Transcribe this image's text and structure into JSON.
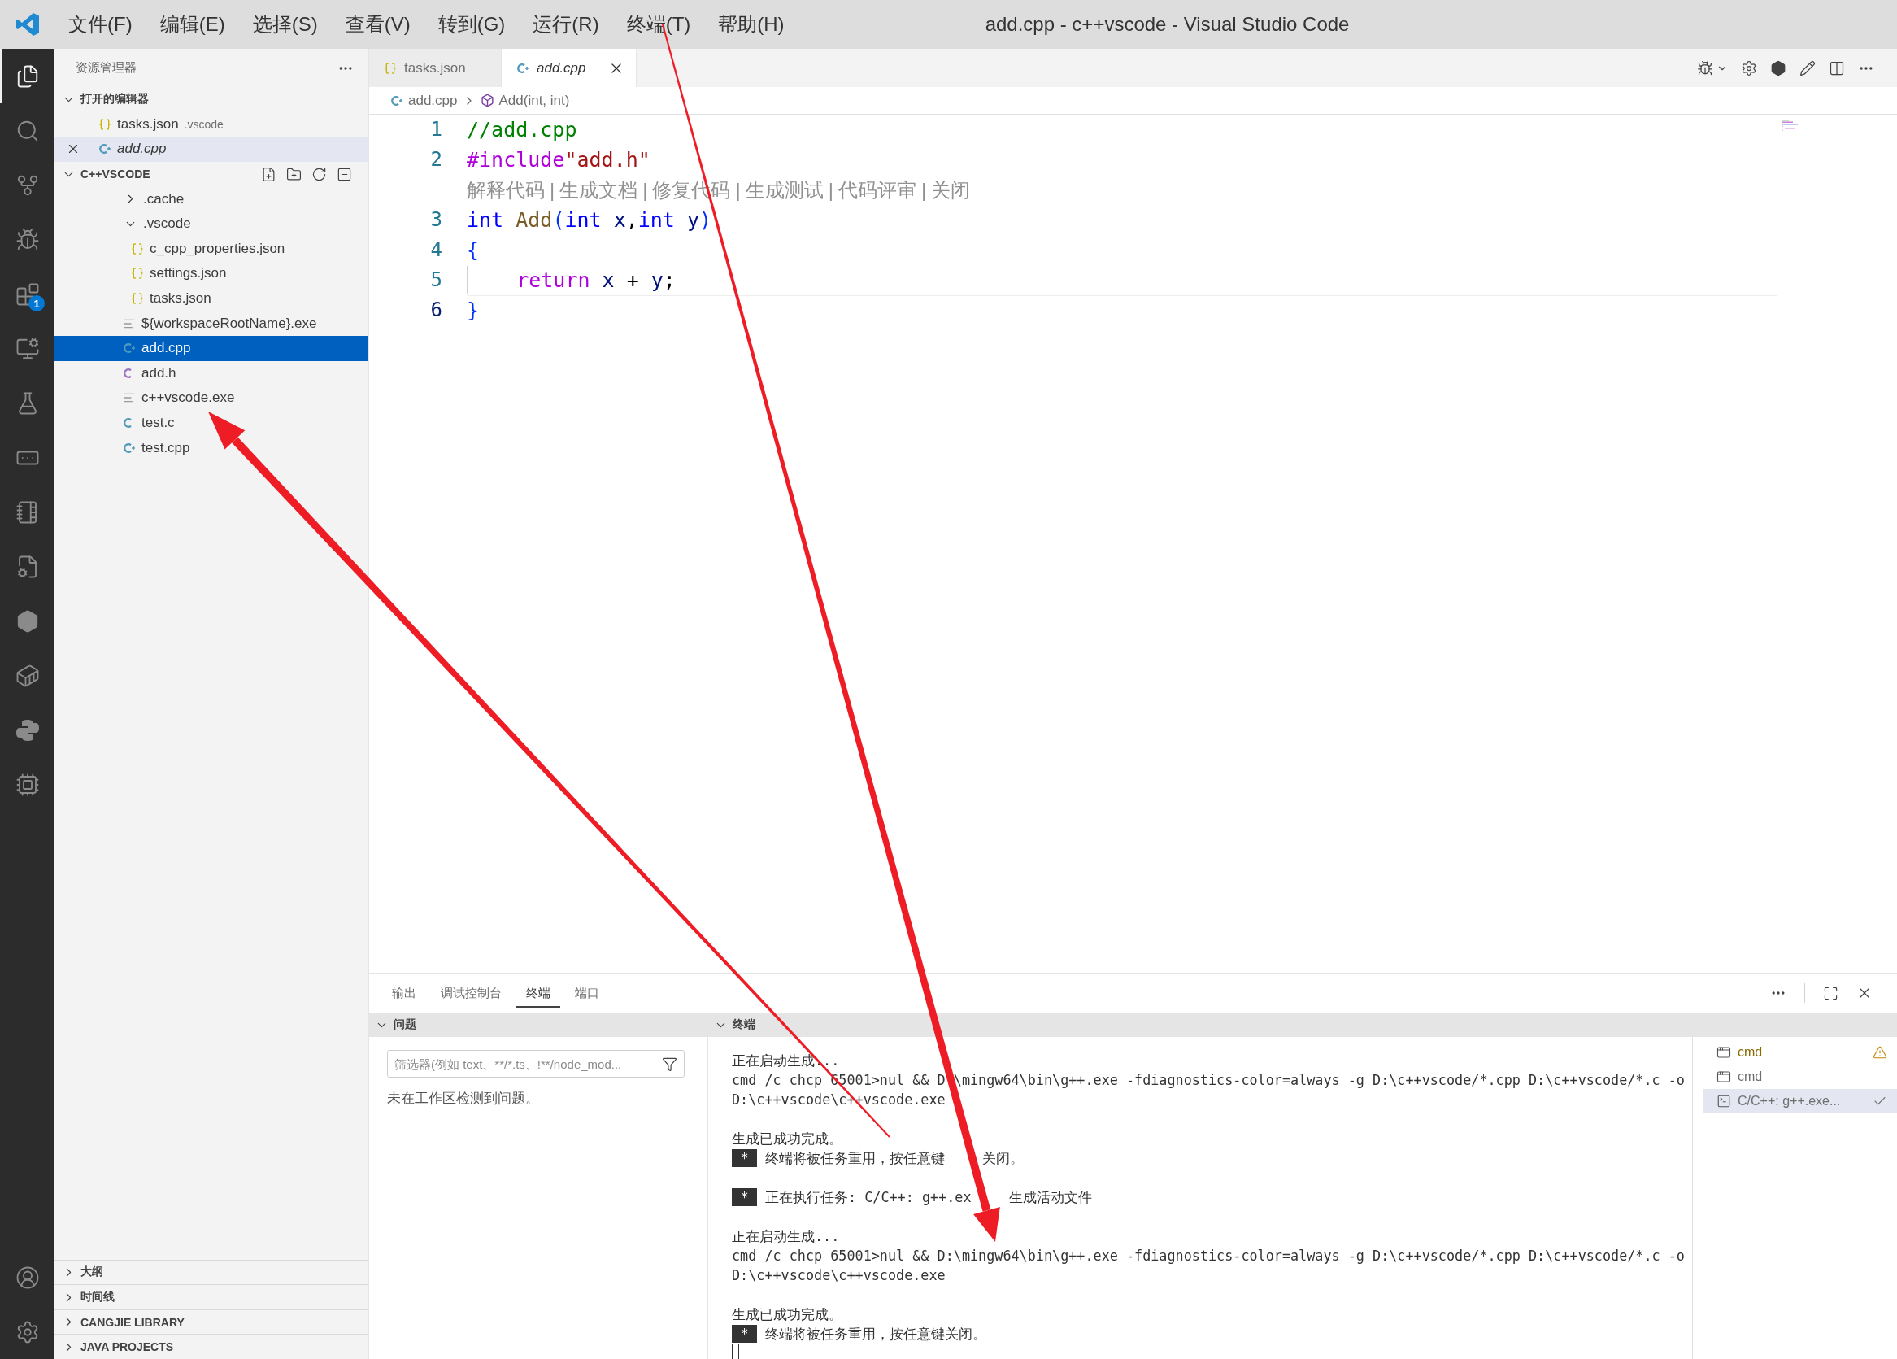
{
  "window": {
    "title": "add.cpp - c++vscode - Visual Studio Code"
  },
  "menu": [
    "文件(F)",
    "编辑(E)",
    "选择(S)",
    "查看(V)",
    "转到(G)",
    "运行(R)",
    "终端(T)",
    "帮助(H)"
  ],
  "activity_bar": {
    "items": [
      {
        "kind": "files",
        "selected": true
      },
      {
        "kind": "search",
        "selected": false
      },
      {
        "kind": "source-control",
        "selected": false
      },
      {
        "kind": "run-debug",
        "selected": false
      },
      {
        "kind": "extensions",
        "selected": false,
        "badge": "1"
      },
      {
        "kind": "remote",
        "selected": false
      },
      {
        "kind": "testing",
        "selected": false
      },
      {
        "kind": "ports",
        "selected": false
      },
      {
        "kind": "notebook",
        "selected": false
      },
      {
        "kind": "file-settings",
        "selected": false
      },
      {
        "kind": "hexagon",
        "selected": false
      },
      {
        "kind": "container",
        "selected": false
      },
      {
        "kind": "python",
        "selected": false
      },
      {
        "kind": "chip",
        "selected": false
      }
    ],
    "bottom": [
      {
        "kind": "account"
      },
      {
        "kind": "settings"
      }
    ]
  },
  "sidebar": {
    "title": "资源管理器",
    "open_editors": {
      "title": "打开的编辑器",
      "expanded": true,
      "items": [
        {
          "name": "tasks.json",
          "description": ".vscode",
          "kind": "json",
          "preview": false,
          "selected": false
        },
        {
          "name": "add.cpp",
          "kind": "cpp",
          "preview": true,
          "selected": true
        }
      ]
    },
    "folder": {
      "title": "C++VSCODE",
      "expanded": true,
      "items": [
        {
          "name": ".cache",
          "kind": "folder",
          "expanded": false
        },
        {
          "name": ".vscode",
          "kind": "folder",
          "expanded": true,
          "children": [
            {
              "name": "c_cpp_properties.json",
              "kind": "json",
              "selected": false
            },
            {
              "name": "settings.json",
              "kind": "json",
              "selected": false
            },
            {
              "name": "tasks.json",
              "kind": "json",
              "selected": false
            }
          ]
        },
        {
          "name": "${workspaceRootName}.exe",
          "kind": "exe",
          "selected": false
        },
        {
          "name": "add.cpp",
          "kind": "cpp",
          "selected": true
        },
        {
          "name": "add.h",
          "kind": "h",
          "selected": false
        },
        {
          "name": "c++vscode.exe",
          "kind": "exe",
          "selected": false
        },
        {
          "name": "test.c",
          "kind": "c",
          "selected": false
        },
        {
          "name": "test.cpp",
          "kind": "cpp",
          "selected": false
        }
      ]
    },
    "sections": [
      {
        "title": "大纲",
        "expanded": false
      },
      {
        "title": "时间线",
        "expanded": false
      },
      {
        "title": "CANGJIE LIBRARY",
        "expanded": false
      },
      {
        "title": "JAVA PROJECTS",
        "expanded": false
      }
    ]
  },
  "editor": {
    "tabs": [
      {
        "label": "tasks.json",
        "kind": "json",
        "selected": false,
        "preview": false
      },
      {
        "label": "add.cpp",
        "kind": "cpp",
        "selected": true,
        "preview": true
      }
    ],
    "breadcrumb": [
      {
        "label": "add.cpp",
        "kind": "cpp"
      },
      {
        "label": "Add(int, int)",
        "kind": "symbol"
      }
    ],
    "lines": [
      {
        "kind": "code",
        "number": "1",
        "current": false,
        "indented": false,
        "tokens": [
          {
            "text": "//add.cpp",
            "kind": "comment"
          }
        ]
      },
      {
        "kind": "code",
        "number": "2",
        "current": false,
        "indented": false,
        "tokens": [
          {
            "text": "#include",
            "kind": "control"
          },
          {
            "text": "\"add.h\"",
            "kind": "string"
          }
        ]
      },
      {
        "kind": "codelens",
        "separator": "|",
        "items": [
          "解释代码",
          "生成文档",
          "修复代码",
          "生成测试",
          "代码评审",
          "关闭"
        ]
      },
      {
        "kind": "code",
        "number": "3",
        "current": false,
        "indented": false,
        "tokens": [
          {
            "text": "int",
            "kind": "type"
          },
          {
            "text": " Add",
            "kind": "function"
          },
          {
            "text": "(",
            "kind": "bracket"
          },
          {
            "text": "int",
            "kind": "type"
          },
          {
            "text": " x",
            "kind": "variable"
          },
          {
            "text": ",",
            "kind": "plain"
          },
          {
            "text": "int",
            "kind": "type"
          },
          {
            "text": " y",
            "kind": "variable"
          },
          {
            "text": ")",
            "kind": "bracket"
          }
        ]
      },
      {
        "kind": "code",
        "number": "4",
        "current": false,
        "indented": false,
        "tokens": [
          {
            "text": "{",
            "kind": "bracket"
          }
        ]
      },
      {
        "kind": "code",
        "number": "5",
        "current": false,
        "indented": true,
        "tokens": [
          {
            "text": "return",
            "kind": "control"
          },
          {
            "text": " x",
            "kind": "variable"
          },
          {
            "text": " + ",
            "kind": "plain"
          },
          {
            "text": "y",
            "kind": "variable"
          },
          {
            "text": ";",
            "kind": "plain"
          }
        ]
      },
      {
        "kind": "code",
        "number": "6",
        "current": true,
        "indented": false,
        "tokens": [
          {
            "text": "}",
            "kind": "bracket"
          }
        ]
      }
    ]
  },
  "panel": {
    "tabs": [
      {
        "label": "输出",
        "selected": false
      },
      {
        "label": "调试控制台",
        "selected": false
      },
      {
        "label": "终端",
        "selected": true
      },
      {
        "label": "端口",
        "selected": false
      }
    ],
    "problems": {
      "title": "问题",
      "expanded": true,
      "filter": {
        "placeholder": "筛选器(例如 text、**/*.ts、!**/node_mod..."
      },
      "message": "未在工作区检测到问题。"
    },
    "terminal": {
      "title": "终端",
      "expanded": true,
      "blocks": [
        {
          "lines": [
            {
              "kind": "text",
              "text": "正在启动生成..."
            },
            {
              "kind": "text",
              "text": "cmd /c chcp 65001>nul && D:\\mingw64\\bin\\g++.exe -fdiagnostics-color=always -g D:\\c++vscode/*.cpp D:\\c++vscode/*.c -o"
            },
            {
              "kind": "text",
              "text": "D:\\c++vscode\\c++vscode.exe"
            }
          ]
        },
        {
          "lines": [
            {
              "kind": "text",
              "text": "生成已成功完成。"
            },
            {
              "kind": "task",
              "badge": "*",
              "parts": [
                "终端将被任务重用，按任意键",
                "关闭。"
              ]
            }
          ]
        },
        {
          "lines": [
            {
              "kind": "task",
              "badge": "*",
              "parts": [
                "正在执行任务: C/C++: g++.ex",
                "生成活动文件"
              ]
            }
          ]
        },
        {
          "lines": [
            {
              "kind": "text",
              "text": "正在启动生成..."
            },
            {
              "kind": "text",
              "text": "cmd /c chcp 65001>nul && D:\\mingw64\\bin\\g++.exe -fdiagnostics-color=always -g D:\\c++vscode/*.cpp D:\\c++vscode/*.c -o"
            },
            {
              "kind": "text",
              "text": "D:\\c++vscode\\c++vscode.exe"
            }
          ]
        },
        {
          "lines": [
            {
              "kind": "text",
              "text": "生成已成功完成。"
            },
            {
              "kind": "task",
              "badge": "*",
              "parts": [
                "终端将被任务重用，按任意键关闭。"
              ]
            }
          ]
        }
      ],
      "sessions": [
        {
          "label": "cmd",
          "kind": "cmd",
          "warning": true,
          "done": false,
          "selected": false
        },
        {
          "label": "cmd",
          "kind": "cmd",
          "warning": false,
          "done": false,
          "selected": false
        },
        {
          "label": "C/C++: g++.exe...",
          "kind": "shell",
          "warning": false,
          "done": true,
          "selected": true
        }
      ]
    }
  }
}
